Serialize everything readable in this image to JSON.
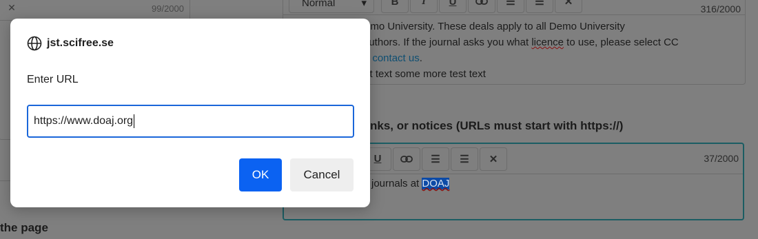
{
  "background": {
    "left_editor": {
      "counter": "99/2000"
    },
    "bottom_heading": "the page",
    "top_editor": {
      "style_value": "Normal",
      "counter": "316/2000",
      "lines": [
        {
          "text": "emo University. These deals apply to all Demo University"
        },
        {
          "pre": "authors. If the journal asks you what ",
          "squiggle": "licence",
          "post": " to use, please select CC"
        },
        {
          "pre": "rt ",
          "link": "contact us",
          "post": "."
        },
        {
          "text": "st text some more test text"
        }
      ]
    },
    "field_label": "nks, or notices (URLs must start with https://)",
    "bottom_editor": {
      "counter": "37/2000",
      "text": "journals at ",
      "selected": "DOAJ"
    },
    "toolbar_glyphs": {
      "bold": "B",
      "italic": "I",
      "underline": "U",
      "link": "🔗",
      "bullets": "☰",
      "numbered": "☰",
      "clear": "✕"
    }
  },
  "dialog": {
    "origin": "jst.scifree.se",
    "message": "Enter URL",
    "input_value": "https://www.doaj.org",
    "ok_label": "OK",
    "cancel_label": "Cancel"
  },
  "colors": {
    "ok": "#0b62f2",
    "focus_border": "#1a66d9",
    "overlay": "#7f7f7f"
  }
}
